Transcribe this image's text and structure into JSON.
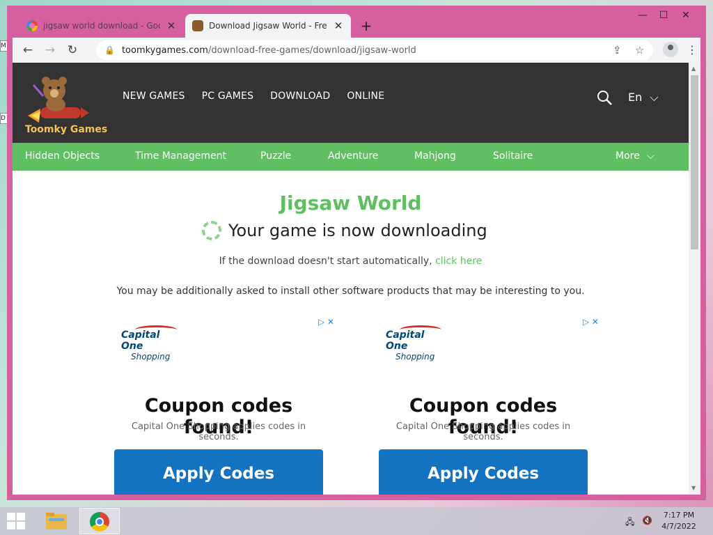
{
  "desktop": {
    "left_icon_letters": [
      "M",
      "D"
    ]
  },
  "browser": {
    "tabs": [
      {
        "title": "jigsaw world download - Google",
        "active": false,
        "icon": "google-icon"
      },
      {
        "title": "Download Jigsaw World - Free P",
        "active": true,
        "icon": "bear-favicon"
      }
    ],
    "new_tab": "+",
    "window_controls": {
      "minimize": "—",
      "maximize": "☐",
      "close": "✕"
    },
    "nav": {
      "back": "←",
      "forward": "→",
      "reload": "↻"
    },
    "url_host": "toomkygames.com",
    "url_path": "/download-free-games/download/jigsaw-world"
  },
  "site": {
    "brand": "Toomky Games",
    "top_nav": [
      "NEW GAMES",
      "PC GAMES",
      "DOWNLOAD",
      "ONLINE"
    ],
    "lang": "En",
    "categories": [
      "Hidden Objects",
      "Time Management",
      "Puzzle",
      "Adventure",
      "Mahjong",
      "Solitaire",
      "More"
    ],
    "accent": "#5fbf62"
  },
  "main": {
    "game_title": "Jigsaw World",
    "downloading": "Your game is now downloading",
    "help_prefix": "If the download doesn't start automatically,",
    "help_link": "click here",
    "note": "You may be additionally asked to install other software products that may be interesting to you."
  },
  "ads": [
    {
      "brand": "Capital One",
      "brand_sub": "Shopping",
      "headline": "Coupon codes found!",
      "sub": "Capital One Shopping applies codes in seconds.",
      "cta": "Apply Codes"
    },
    {
      "brand": "Capital One",
      "brand_sub": "Shopping",
      "headline": "Coupon codes found!",
      "sub": "Capital One Shopping applies codes in seconds.",
      "cta": "Apply Codes"
    }
  ],
  "taskbar": {
    "time": "7:17 PM",
    "date": "4/7/2022"
  }
}
